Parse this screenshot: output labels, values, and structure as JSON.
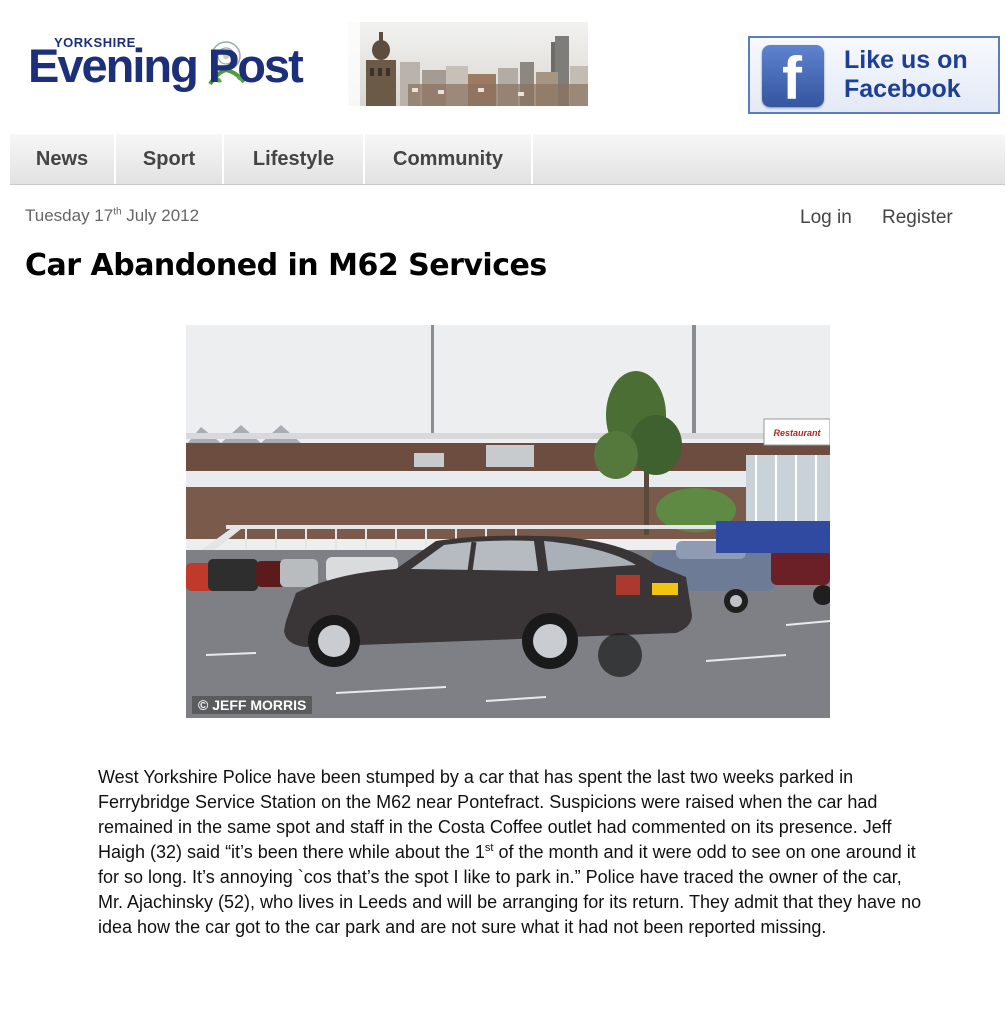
{
  "header": {
    "logo_small": "YORKSHIRE",
    "logo_text": "Evening Post",
    "facebook_text": "Like us on Facebook"
  },
  "nav": {
    "items": [
      {
        "label": "News"
      },
      {
        "label": "Sport"
      },
      {
        "label": "Lifestyle"
      },
      {
        "label": "Community"
      }
    ]
  },
  "topbar": {
    "date_day": "Tuesday 17",
    "date_suffix": "th",
    "date_rest": " July 2012",
    "login": "Log in",
    "register": "Register"
  },
  "article": {
    "headline": "Car Abandoned in M62 Services",
    "photo_credit": "© JEFF MORRIS",
    "restaurant_sign": "Restaurant",
    "body_part1": "West Yorkshire Police have been stumped by a car that has spent the last two weeks parked in Ferrybridge Service Station on the M62 near Pontefract.  Suspicions were raised when the car had remained in the same spot and staff in the Costa Coffee outlet had commented on its presence.  Jeff Haigh (32) said “it’s been there while about the 1",
    "body_sup": "st",
    "body_part2": " of the month and it were odd to see on one around it for so long.  It’s annoying `cos that’s the spot I like to park in.” Police have traced the owner of the car, Mr. Ajachinsky (52), who lives in Leeds and will be arranging for its return.  They admit that they have no idea how the car got to the car park and are not sure what it had not been reported missing."
  },
  "colors": {
    "brand_blue": "#1c2f7a",
    "facebook_blue": "#3b5998"
  }
}
